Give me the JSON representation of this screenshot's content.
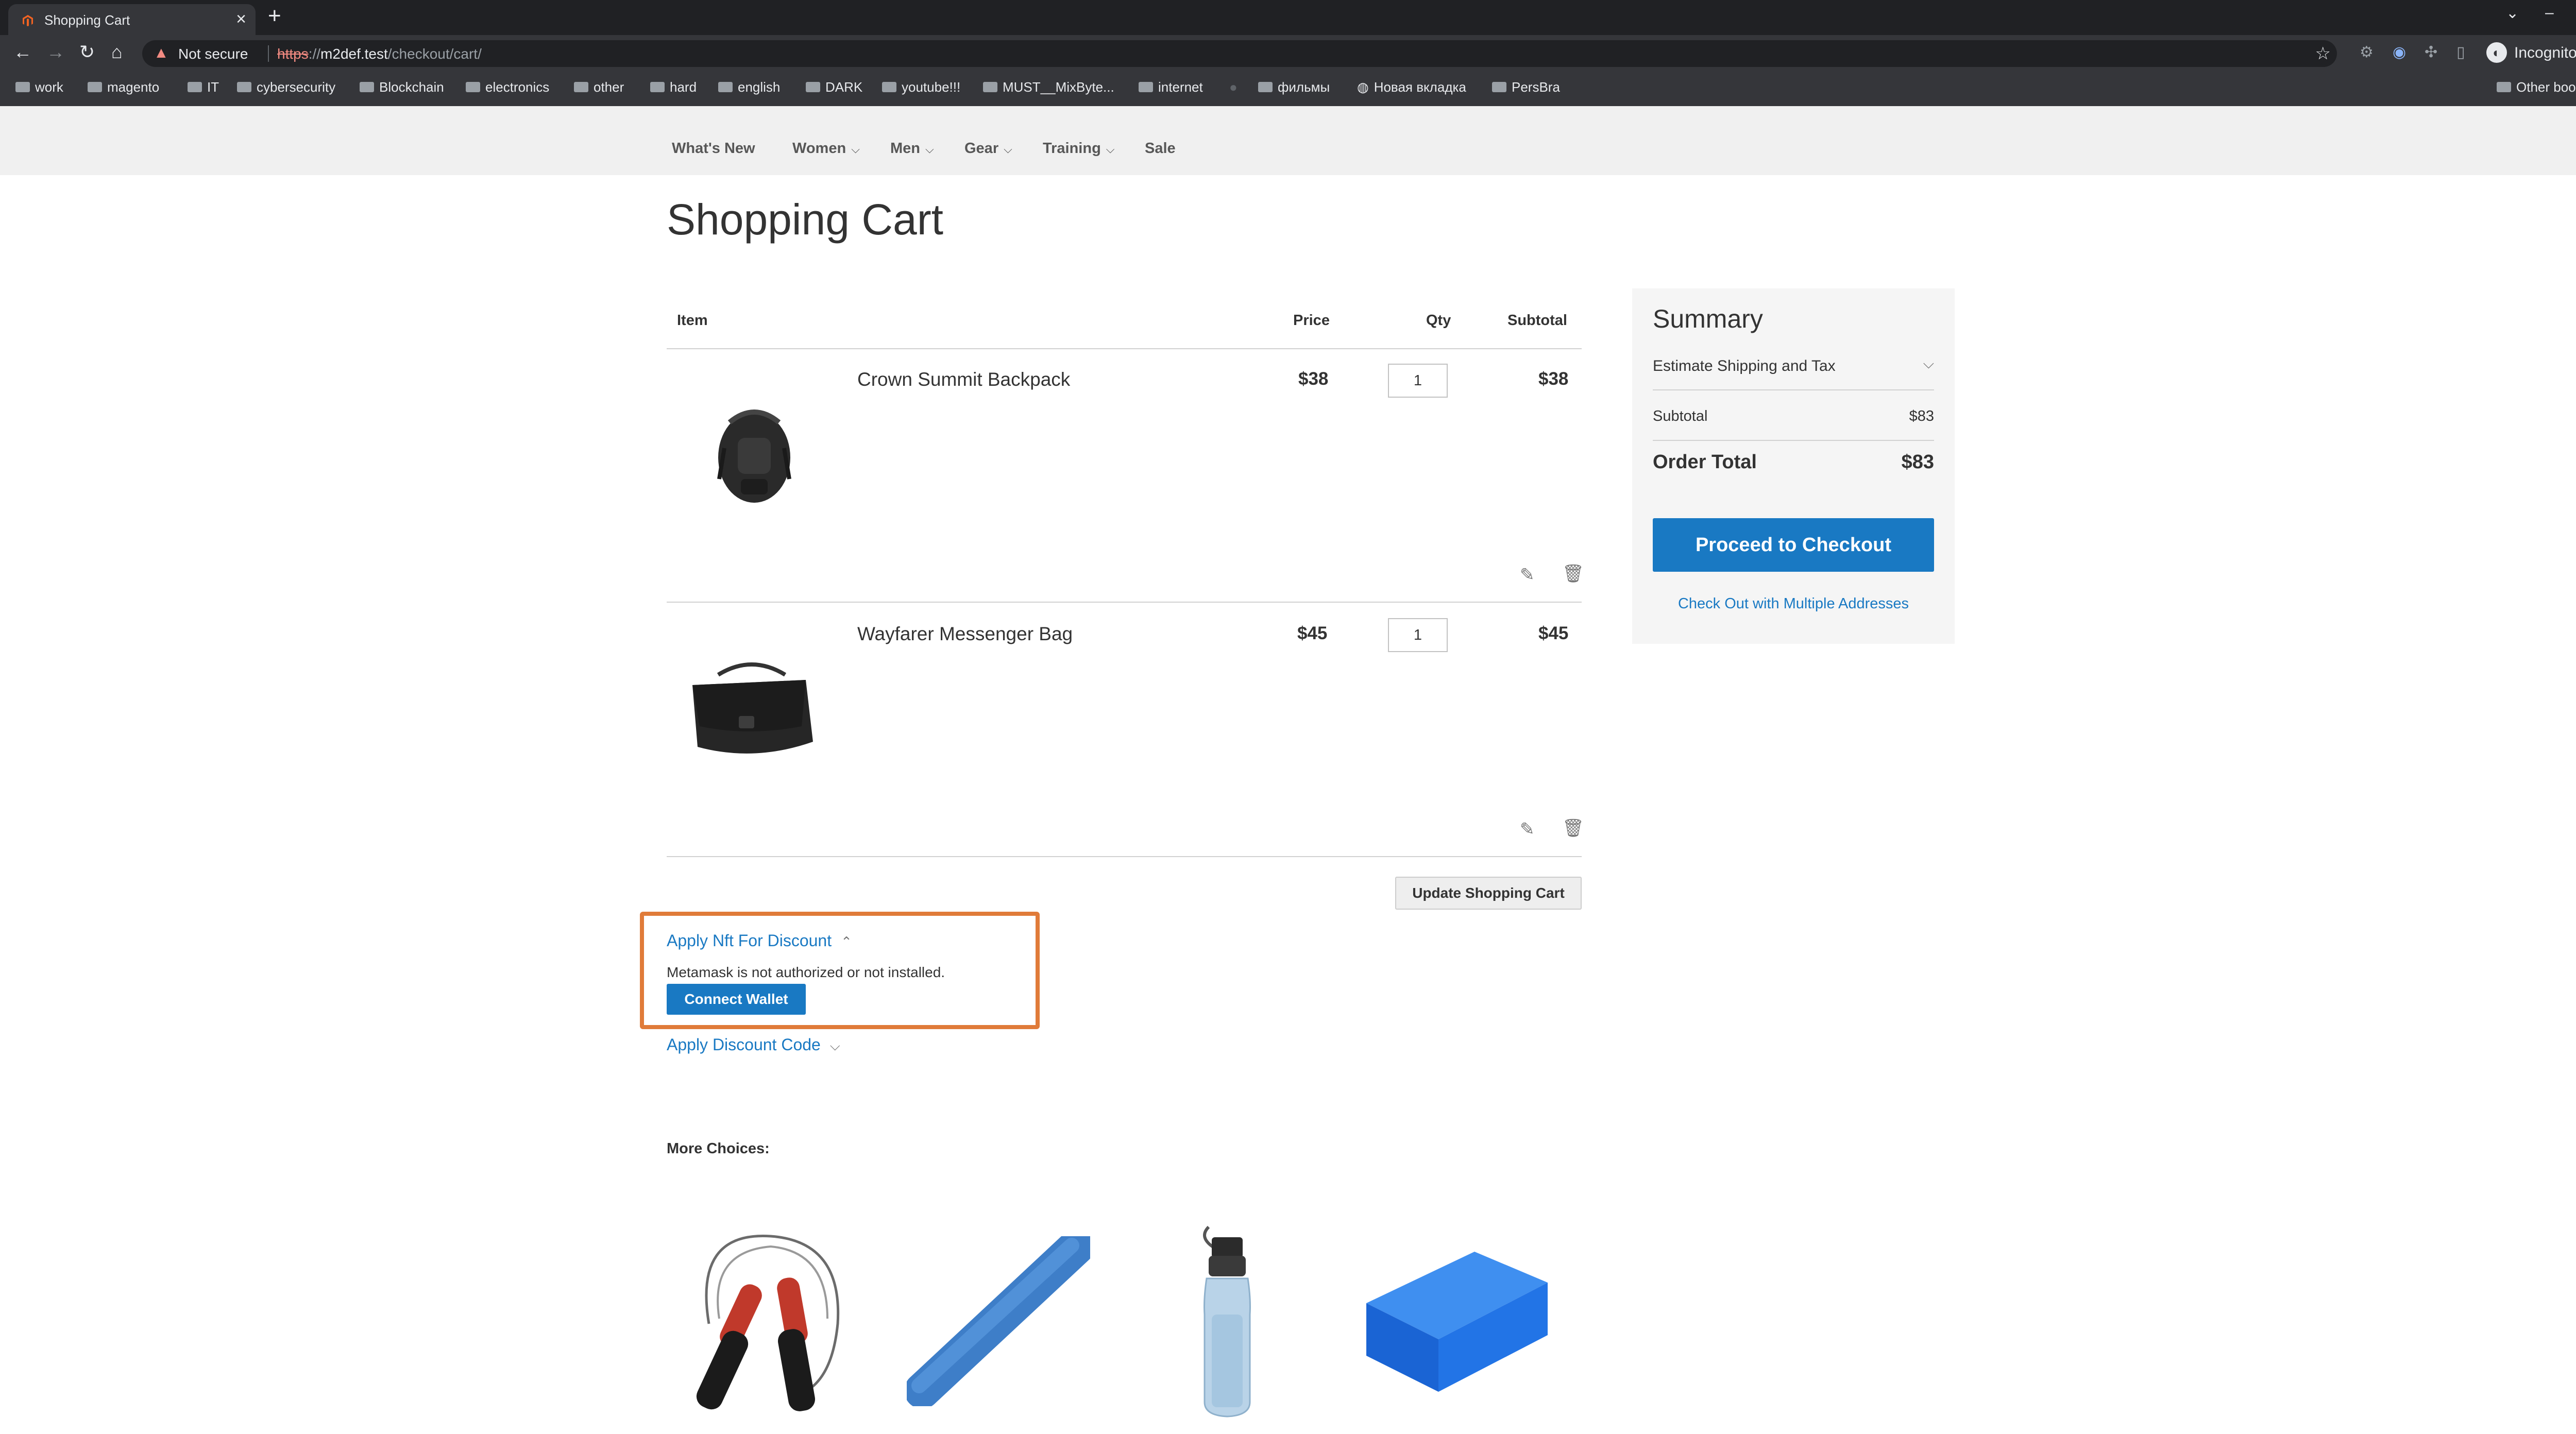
{
  "browser": {
    "tab_title": "Shopping Cart",
    "new_tab": "+",
    "not_secure": "Not secure",
    "url_scheme": "https",
    "url_host": "m2def.test",
    "url_path": "/checkout/cart/",
    "profile_label": "Incognito",
    "bookmarks": [
      "work",
      "magento",
      "IT",
      "cybersecurity",
      "Blockchain",
      "electronics",
      "other",
      "hard",
      "english",
      "DARK",
      "youtube!!!",
      "MUST__MixByte...",
      "internet",
      "фильмы",
      "Новая вкладка",
      "PersBra"
    ],
    "other_bookmarks": "Other bookmarks"
  },
  "nav": {
    "items": [
      "What's New",
      "Women",
      "Men",
      "Gear",
      "Training",
      "Sale"
    ]
  },
  "page": {
    "title": "Shopping Cart"
  },
  "cart": {
    "headers": {
      "item": "Item",
      "price": "Price",
      "qty": "Qty",
      "subtotal": "Subtotal"
    },
    "rows": [
      {
        "name": "Crown Summit Backpack",
        "price": "$38",
        "qty": "1",
        "subtotal": "$38"
      },
      {
        "name": "Wayfarer Messenger Bag",
        "price": "$45",
        "qty": "1",
        "subtotal": "$45"
      }
    ],
    "update_label": "Update Shopping Cart"
  },
  "nft": {
    "title": "Apply Nft For Discount",
    "message": "Metamask is not authorized or not installed.",
    "connect_label": "Connect Wallet"
  },
  "discount": {
    "title": "Apply Discount Code"
  },
  "more_choices": {
    "title": "More Choices:"
  },
  "summary": {
    "title": "Summary",
    "estimate_label": "Estimate Shipping and Tax",
    "subtotal_label": "Subtotal",
    "subtotal_value": "$83",
    "order_total_label": "Order Total",
    "order_total_value": "$83",
    "checkout_label": "Proceed to Checkout",
    "multi_label": "Check Out with Multiple Addresses"
  },
  "colors": {
    "accent": "#1979c3",
    "highlight_box": "#e07b39",
    "chrome_dark": "#202124",
    "chrome": "#35363a"
  }
}
